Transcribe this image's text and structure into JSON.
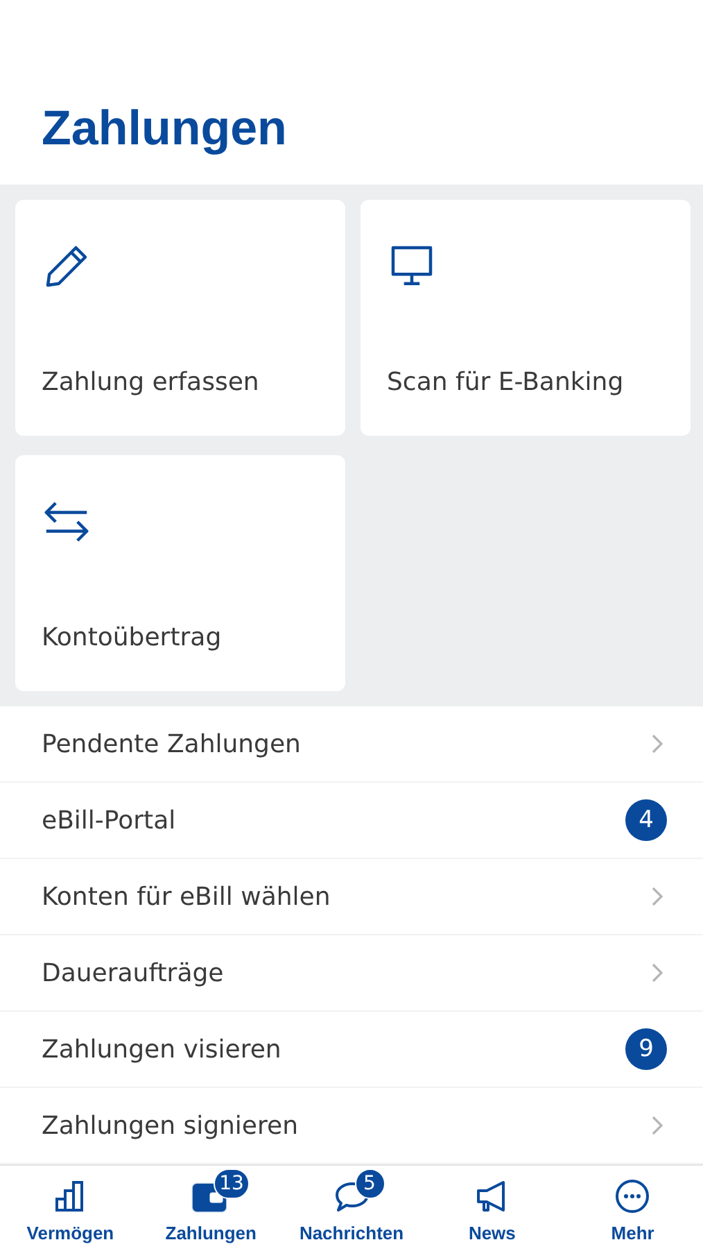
{
  "title": "Zahlungen",
  "tiles": [
    {
      "label": "Zahlung erfassen"
    },
    {
      "label": "Scan für E-Banking"
    },
    {
      "label": "Kontoübertrag"
    }
  ],
  "rows": [
    {
      "label": "Pendente Zahlungen"
    },
    {
      "label": "eBill-Portal",
      "badge": "4"
    },
    {
      "label": "Konten für eBill wählen"
    },
    {
      "label": "Daueraufträge"
    },
    {
      "label": "Zahlungen visieren",
      "badge": "9"
    },
    {
      "label": "Zahlungen signieren"
    }
  ],
  "tabs": [
    {
      "label": "Vermögen",
      "selected": false
    },
    {
      "label": "Zahlungen",
      "selected": true,
      "badge": "13"
    },
    {
      "label": "Nachrichten",
      "selected": false,
      "badge": "5"
    },
    {
      "label": "News",
      "selected": false
    },
    {
      "label": "Mehr",
      "selected": false
    }
  ]
}
